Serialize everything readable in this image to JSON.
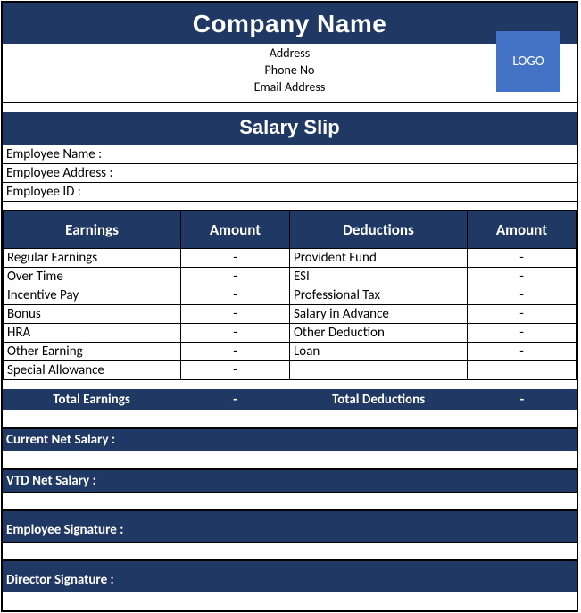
{
  "header": {
    "company_name": "Company Name",
    "address": "Address",
    "phone": "Phone No",
    "email": "Email Address",
    "logo_text": "LOGO"
  },
  "title": "Salary Slip",
  "employee": {
    "name_label": "Employee Name :",
    "address_label": "Employee Address :",
    "id_label": "Employee ID :"
  },
  "columns": {
    "earnings": "Earnings",
    "amount1": "Amount",
    "deductions": "Deductions",
    "amount2": "Amount"
  },
  "earnings": [
    {
      "label": "Regular Earnings",
      "amount": "-"
    },
    {
      "label": "Over Time",
      "amount": "-"
    },
    {
      "label": "Incentive Pay",
      "amount": "-"
    },
    {
      "label": "Bonus",
      "amount": "-"
    },
    {
      "label": "HRA",
      "amount": "-"
    },
    {
      "label": "Other Earning",
      "amount": "-"
    },
    {
      "label": "Special Allowance",
      "amount": "-"
    }
  ],
  "deductions": [
    {
      "label": "Provident Fund",
      "amount": "-"
    },
    {
      "label": "ESI",
      "amount": "-"
    },
    {
      "label": "Professional Tax",
      "amount": "-"
    },
    {
      "label": "Salary in Advance",
      "amount": "-"
    },
    {
      "label": "Other Deduction",
      "amount": "-"
    },
    {
      "label": "Loan",
      "amount": "-"
    },
    {
      "label": "",
      "amount": ""
    }
  ],
  "totals": {
    "total_earnings_label": "Total Earnings",
    "total_earnings_value": "-",
    "total_deductions_label": "Total Deductions",
    "total_deductions_value": "-"
  },
  "footer": {
    "current_net": "Current Net Salary :",
    "vtd_net": "VTD Net Salary :",
    "emp_sig": "Employee Signature :",
    "dir_sig": "Director Signature :"
  }
}
